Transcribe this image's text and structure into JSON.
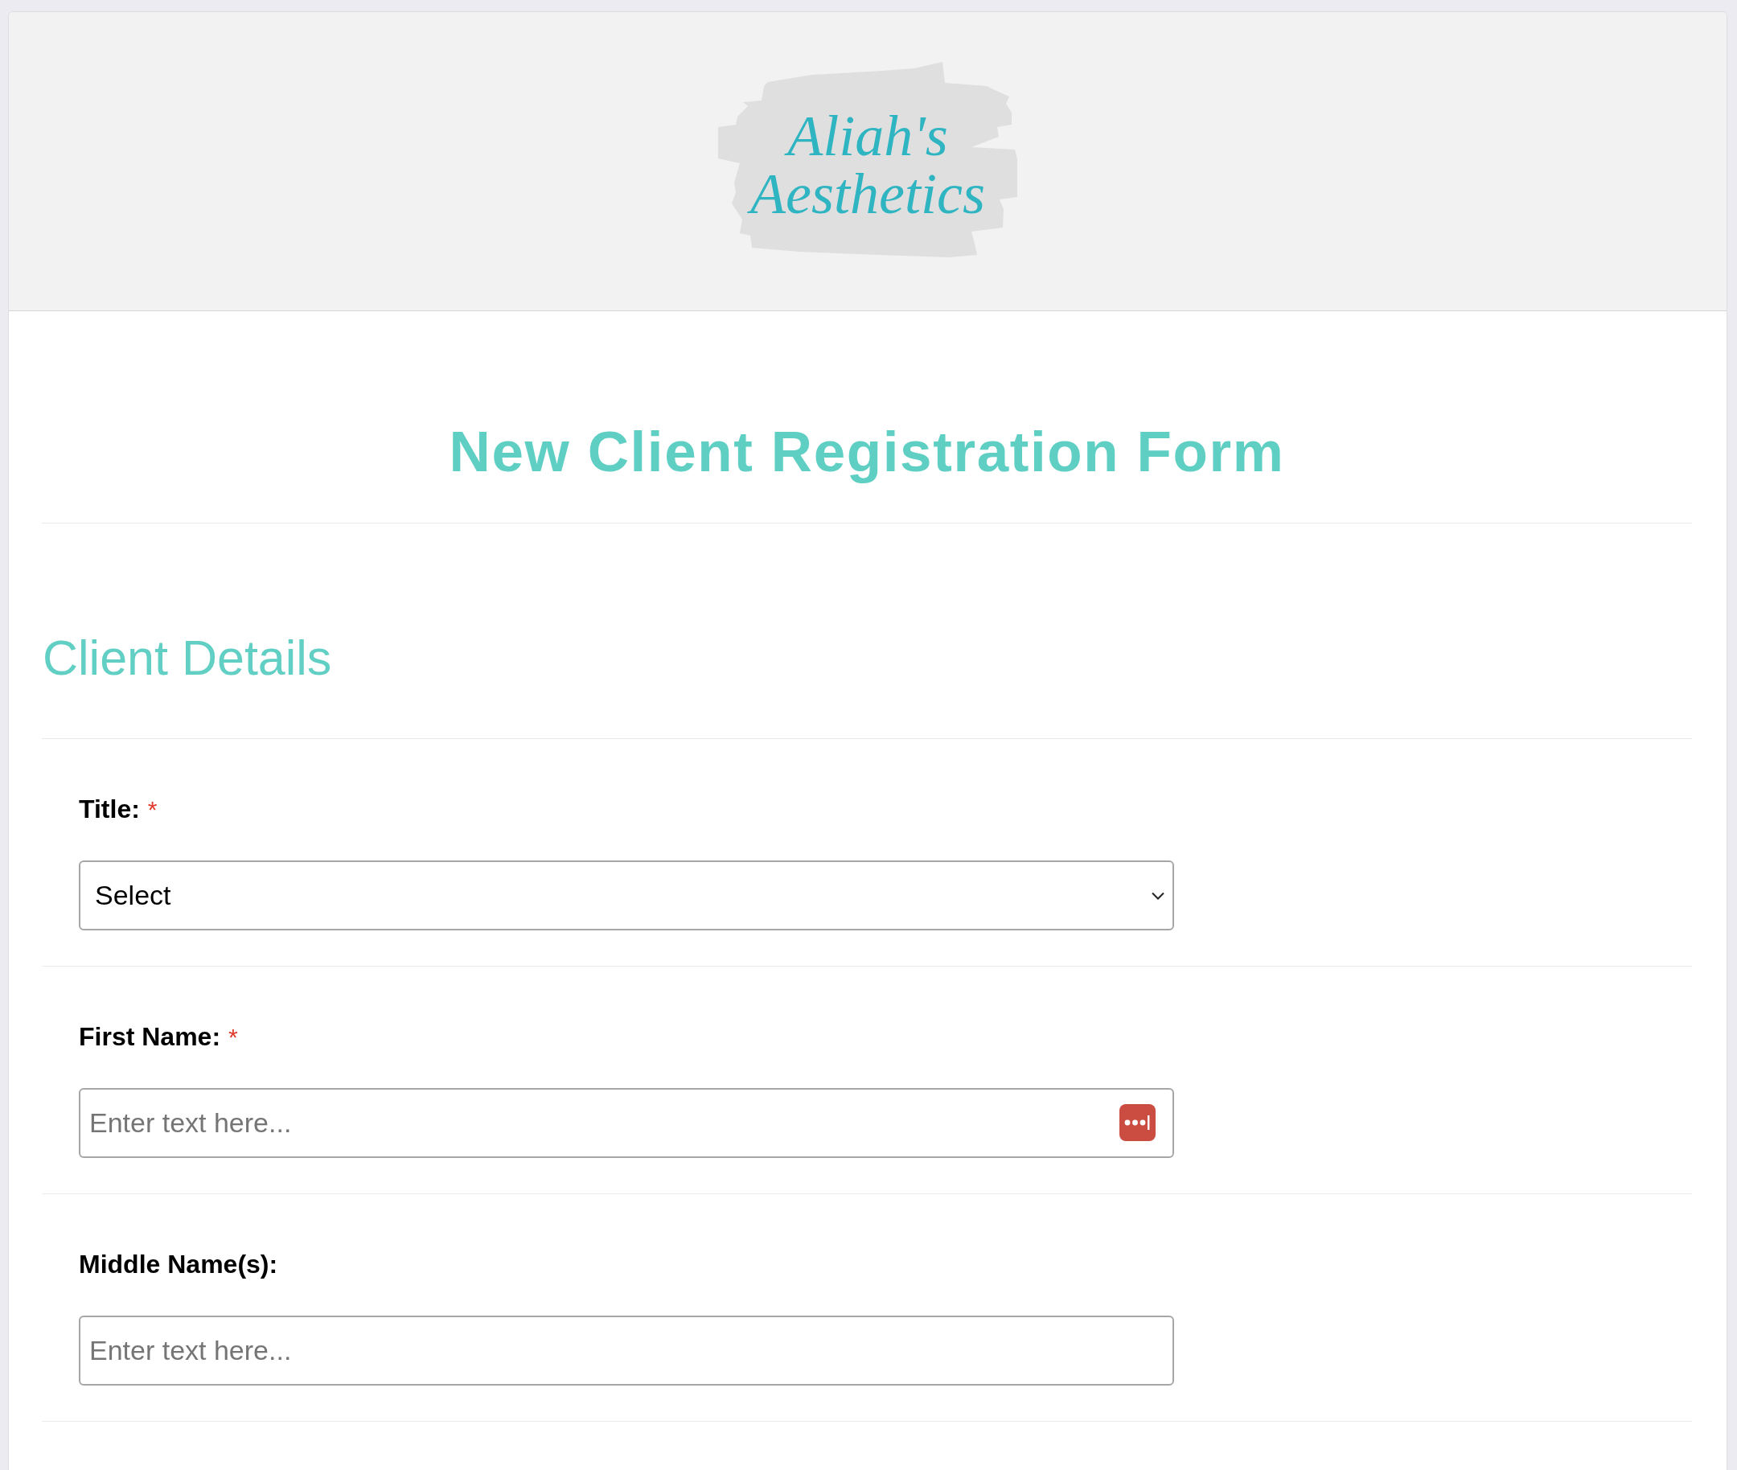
{
  "header": {
    "logo": {
      "lines": [
        "Aliah's",
        "Aesthetics"
      ]
    }
  },
  "form": {
    "title": "New Client Registration Form",
    "required_mark": "*",
    "sections": [
      {
        "heading": "Client Details",
        "fields": [
          {
            "kind": "select",
            "label": "Title:",
            "required": true,
            "value": "Select"
          },
          {
            "kind": "text",
            "label": "First Name:",
            "required": true,
            "placeholder": "Enter text here...",
            "password_manager_icon": true
          },
          {
            "kind": "text",
            "label": "Middle Name(s):",
            "required": false,
            "placeholder": "Enter text here...",
            "password_manager_icon": false
          }
        ]
      }
    ]
  }
}
